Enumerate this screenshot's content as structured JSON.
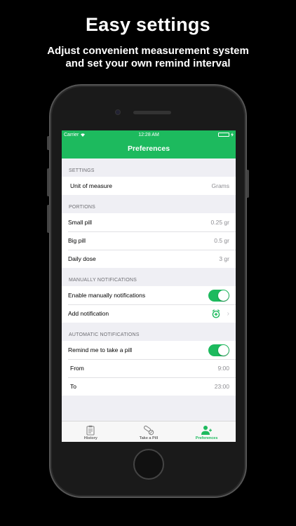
{
  "promo": {
    "title": "Easy settings",
    "subtitle_line1": "Adjust convenient measurement system",
    "subtitle_line2": "and set your own remind interval"
  },
  "statusbar": {
    "carrier": "Carrier",
    "time": "12:28 AM"
  },
  "navbar": {
    "title": "Preferences"
  },
  "settings": {
    "header": "SETTINGS",
    "unit_label": "Unit of measure",
    "unit_value": "Grams"
  },
  "portions": {
    "header": "PORTIONS",
    "items": [
      {
        "label": "Small pill",
        "value": "0.25 gr"
      },
      {
        "label": "Big pill",
        "value": "0.5 gr"
      },
      {
        "label": "Daily dose",
        "value": "3 gr"
      }
    ]
  },
  "manual": {
    "header": "MANUALLY NOTIFICATIONS",
    "enable_label": "Enable manually notifications",
    "enable_on": true,
    "add_label": "Add notification"
  },
  "automatic": {
    "header": "AUTOMATIC NOTIFICATIONS",
    "remind_label": "Remind me to take a pill",
    "remind_on": true,
    "from_label": "From",
    "from_value": "9:00",
    "to_label": "To",
    "to_value": "23:00"
  },
  "tabs": [
    {
      "label": "History",
      "icon": "clipboard-icon",
      "active": false
    },
    {
      "label": "Take a Pill",
      "icon": "pills-icon",
      "active": false
    },
    {
      "label": "Preferences",
      "icon": "user-settings-icon",
      "active": true
    }
  ],
  "colors": {
    "accent": "#1dba5e",
    "background": "#efeff4"
  }
}
